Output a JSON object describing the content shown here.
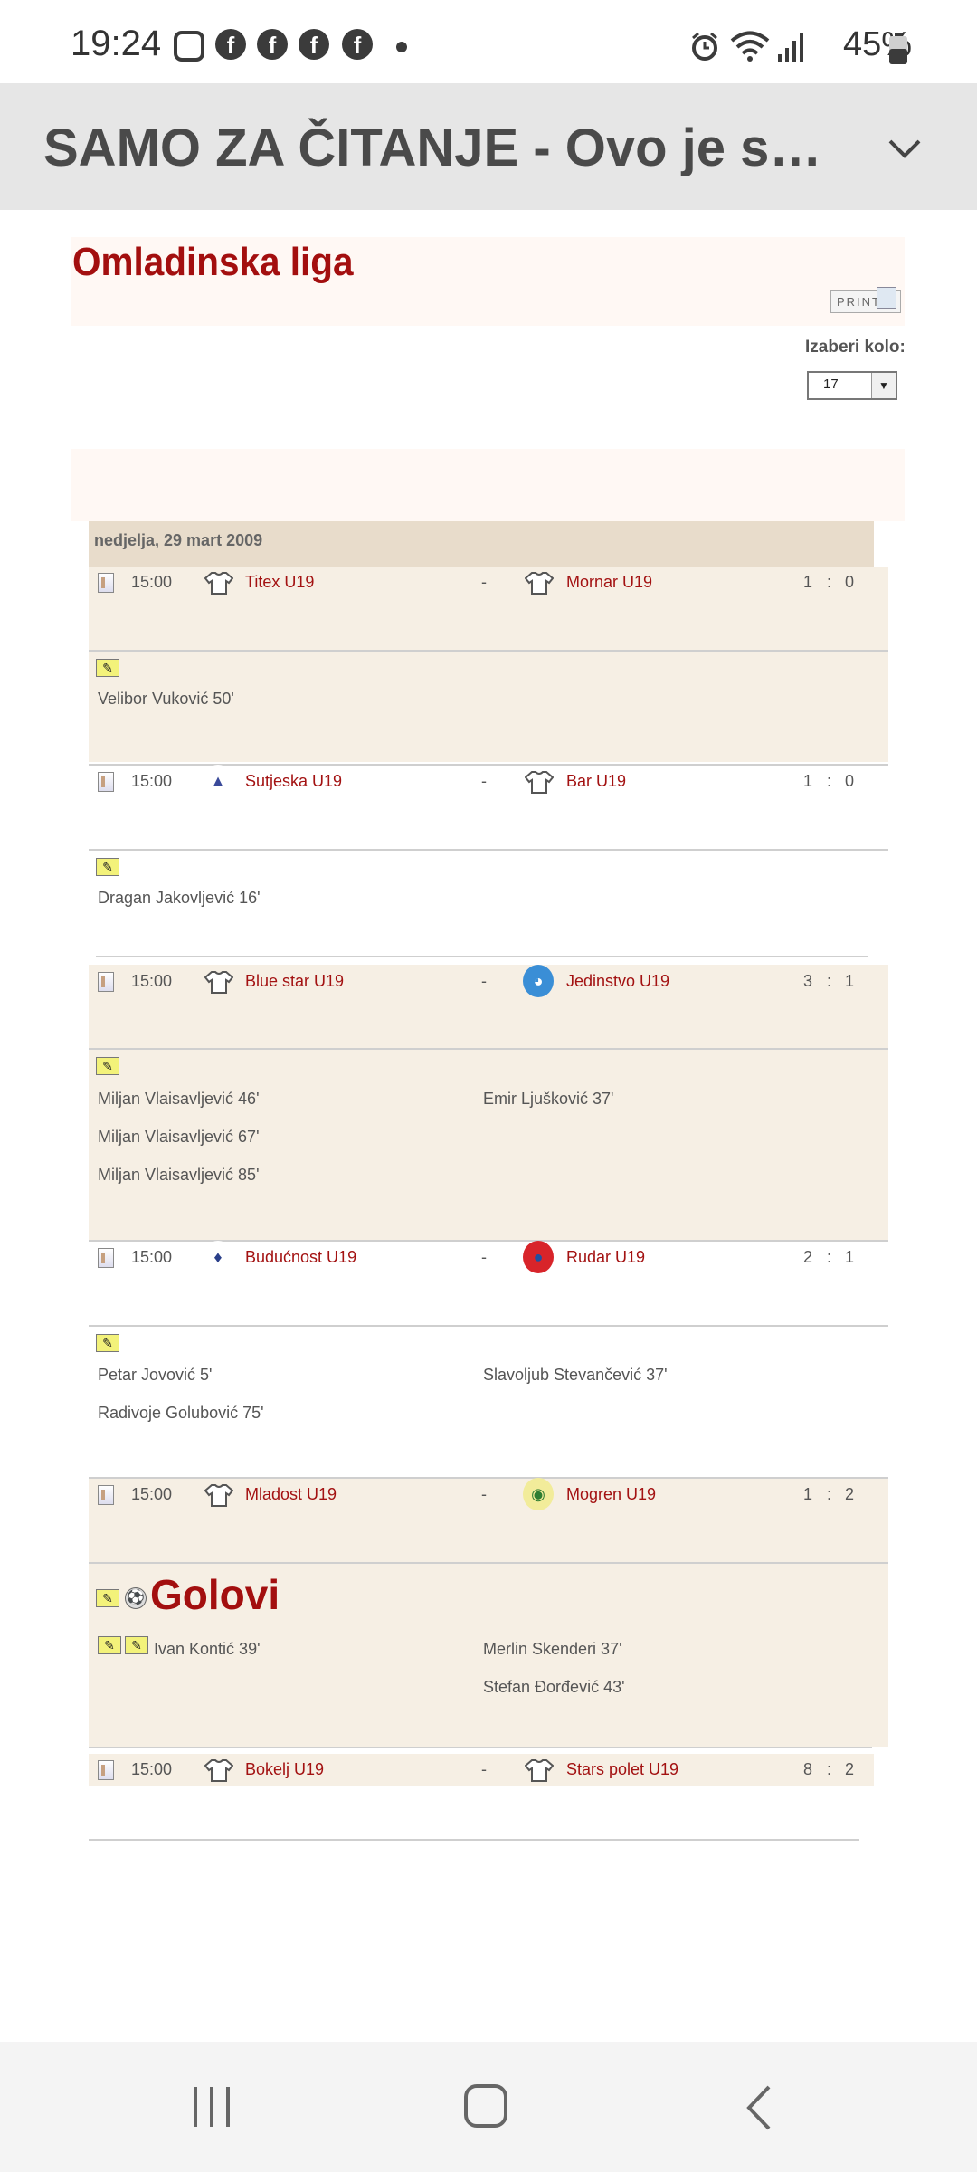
{
  "status_bar": {
    "time": "19:24",
    "battery": "45%",
    "notification_icons": [
      "instagram-icon",
      "facebook-icon",
      "facebook-icon",
      "facebook-icon",
      "facebook-icon"
    ],
    "system_icons": [
      "alarm-icon",
      "wifi-icon",
      "signal-icon",
      "battery-icon"
    ]
  },
  "header": {
    "title": "SAMO ZA ČITANJE - Ovo je s…"
  },
  "page": {
    "league_title": "Omladinska liga",
    "print_label": "PRINT",
    "round_label": "Izaberi kolo:",
    "round_value": "17",
    "date": "nedjelja, 29 mart 2009",
    "goals_label": "Golovi"
  },
  "matches": [
    {
      "time": "15:00",
      "home": "Titex U19",
      "sep": "-",
      "away": "Mornar U19",
      "home_score": "1",
      "colon": ":",
      "away_score": "0",
      "home_scorers": [
        "Velibor Vuković 50'"
      ],
      "away_scorers": []
    },
    {
      "time": "15:00",
      "home": "Sutjeska U19",
      "sep": "-",
      "away": "Bar U19",
      "home_score": "1",
      "colon": ":",
      "away_score": "0",
      "home_scorers": [
        "Dragan Jakovljević 16'"
      ],
      "away_scorers": []
    },
    {
      "time": "15:00",
      "home": "Blue star U19",
      "sep": "-",
      "away": "Jedinstvo U19",
      "home_score": "3",
      "colon": ":",
      "away_score": "1",
      "home_scorers": [
        "Miljan Vlaisavljević 46'",
        "Miljan Vlaisavljević 67'",
        "Miljan Vlaisavljević 85'"
      ],
      "away_scorers": [
        "Emir Ljušković 37'"
      ]
    },
    {
      "time": "15:00",
      "home": "Budućnost U19",
      "sep": "-",
      "away": "Rudar U19",
      "home_score": "2",
      "colon": ":",
      "away_score": "1",
      "home_scorers": [
        "Petar Jovović 5'",
        "Radivoje Golubović 75'"
      ],
      "away_scorers": [
        "Slavoljub Stevančević 37'"
      ]
    },
    {
      "time": "15:00",
      "home": "Mladost U19",
      "sep": "-",
      "away": "Mogren U19",
      "home_score": "1",
      "colon": ":",
      "away_score": "2",
      "home_scorers": [
        "Ivan Kontić 39'"
      ],
      "away_scorers": [
        "Merlin Skenderi 37'",
        "Stefan Đorđević 43'"
      ]
    },
    {
      "time": "15:00",
      "home": "Bokelj U19",
      "sep": "-",
      "away": "Stars polet U19",
      "home_score": "8",
      "colon": ":",
      "away_score": "2",
      "home_scorers": [],
      "away_scorers": []
    }
  ],
  "colors": {
    "team_link": "#a31212",
    "band": "#f6efe4",
    "date_bar": "#e8dccb",
    "header_bg": "#e6e6e6"
  }
}
